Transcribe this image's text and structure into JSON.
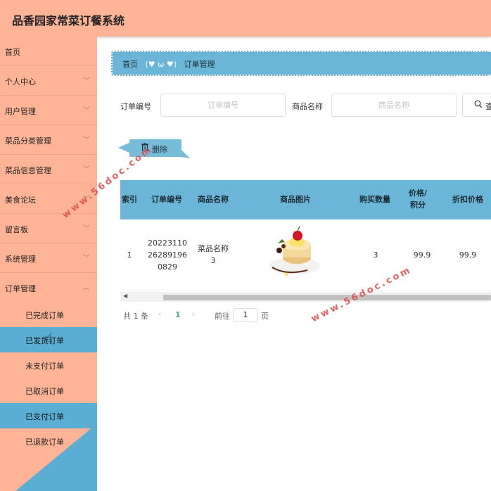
{
  "header": {
    "title": "品香园家常菜订餐系统"
  },
  "sidebar": {
    "items": [
      {
        "label": "首页",
        "chevron": false
      },
      {
        "label": "个人中心",
        "chevron": true
      },
      {
        "label": "用户管理",
        "chevron": true
      },
      {
        "label": "菜品分类管理",
        "chevron": true
      },
      {
        "label": "菜品信息管理",
        "chevron": true
      },
      {
        "label": "美食论坛",
        "chevron": true
      },
      {
        "label": "留言板",
        "chevron": true
      },
      {
        "label": "系统管理",
        "chevron": true
      },
      {
        "label": "订单管理",
        "chevron": true,
        "expanded": true
      }
    ],
    "sub_items": [
      {
        "label": "已完成订单",
        "active": false
      },
      {
        "label": "已发货订单",
        "active": true
      },
      {
        "label": "未支付订单",
        "active": false
      },
      {
        "label": "已取消订单",
        "active": false
      },
      {
        "label": "已支付订单",
        "active": true
      },
      {
        "label": "已退款订单",
        "active": false
      }
    ]
  },
  "breadcrumb": {
    "home": "首页",
    "emoticon": "(♥ ω ♥)",
    "current": "订单管理"
  },
  "search": {
    "order_no_label": "订单编号",
    "order_no_placeholder": "订单编号",
    "product_label": "商品名称",
    "product_placeholder": "商品名称",
    "button_label": "查",
    "button_icon": "search-icon"
  },
  "toolbar": {
    "delete_label": "删除",
    "delete_icon": "trash-icon"
  },
  "table": {
    "columns": [
      "索引",
      "订单编号",
      "商品名称",
      "商品图片",
      "购买数量",
      "价格/积分",
      "折扣价格"
    ],
    "rows": [
      {
        "index": "1",
        "order_no": "20223110262891960829",
        "product": "菜品名称3",
        "image": "dessert-image",
        "quantity": "3",
        "price": "99.9",
        "discount": "99.9"
      }
    ]
  },
  "pagination": {
    "total": "共 1 条",
    "current_page": "1",
    "goto_prefix": "前往",
    "goto_value": "1",
    "goto_suffix": "页"
  },
  "watermark": {
    "text": "www.56doc.com"
  },
  "colors": {
    "header": "#ffb497",
    "sidebar": "#ffb497",
    "accent": "#5aaed3",
    "table_head": "#6ab5d8"
  }
}
